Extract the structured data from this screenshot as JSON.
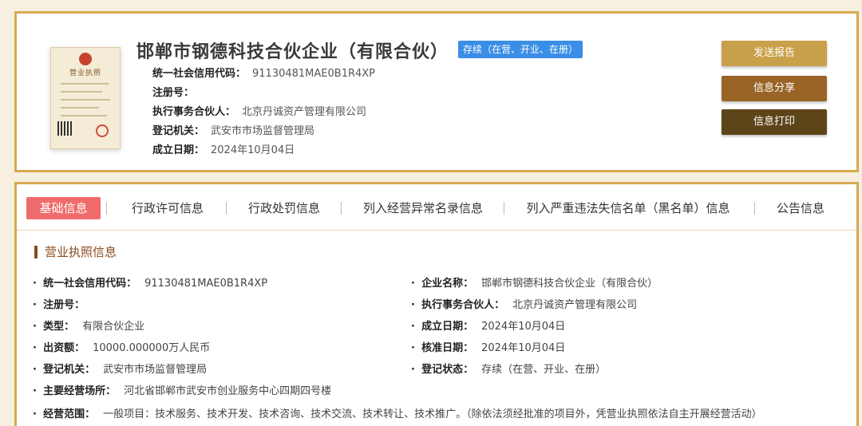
{
  "header": {
    "license_thumbnail": {
      "title": "营业执照"
    },
    "company_name": "邯郸市钢德科技合伙企业（有限合伙）",
    "status_tag": "存续（在营、开业、在册）",
    "meta": [
      {
        "label": "统一社会信用代码：",
        "value": "91130481MAE0B1R4XP"
      },
      {
        "label": "注册号：",
        "value": ""
      },
      {
        "label": "执行事务合伙人：",
        "value": "北京丹诚资产管理有限公司"
      },
      {
        "label": "登记机关：",
        "value": "武安市市场监督管理局"
      },
      {
        "label": "成立日期：",
        "value": "2024年10月04日"
      }
    ],
    "buttons": {
      "send_report": "发送报告",
      "share": "信息分享",
      "print": "信息打印"
    }
  },
  "tabs": [
    "基础信息",
    "行政许可信息",
    "行政处罚信息",
    "列入经营异常名录信息",
    "列入严重违法失信名单（黑名单）信息",
    "公告信息"
  ],
  "section_title": "营业执照信息",
  "details": {
    "credit_code": {
      "label": "统一社会信用代码：",
      "value": "91130481MAE0B1R4XP"
    },
    "company_name": {
      "label": "企业名称：",
      "value": "邯郸市钢德科技合伙企业（有限合伙）"
    },
    "reg_no": {
      "label": "注册号：",
      "value": ""
    },
    "partner": {
      "label": "执行事务合伙人：",
      "value": "北京丹诚资产管理有限公司"
    },
    "type": {
      "label": "类型：",
      "value": "有限合伙企业"
    },
    "established": {
      "label": "成立日期：",
      "value": "2024年10月04日"
    },
    "capital": {
      "label": "出资额：",
      "value": "10000.000000万人民币"
    },
    "approved": {
      "label": "核准日期：",
      "value": "2024年10月04日"
    },
    "authority": {
      "label": "登记机关：",
      "value": "武安市市场监督管理局"
    },
    "status": {
      "label": "登记状态：",
      "value": "存续（在营、开业、在册）"
    },
    "address": {
      "label": "主要经营场所：",
      "value": "河北省邯郸市武安市创业服务中心四期四号楼"
    },
    "scope": {
      "label": "经营范围：",
      "value": "一般项目：技术服务、技术开发、技术咨询、技术交流、技术转让、技术推广。（除依法须经批准的项目外，凭营业执照依法自主开展经营活动）"
    }
  },
  "colors": {
    "border": "#d6aa4e",
    "active_tab": "#f06b6b",
    "status_tag": "#3a8ee6",
    "btn_send": "#c9a04a",
    "btn_share": "#9a6427",
    "btn_print": "#5e4419"
  }
}
